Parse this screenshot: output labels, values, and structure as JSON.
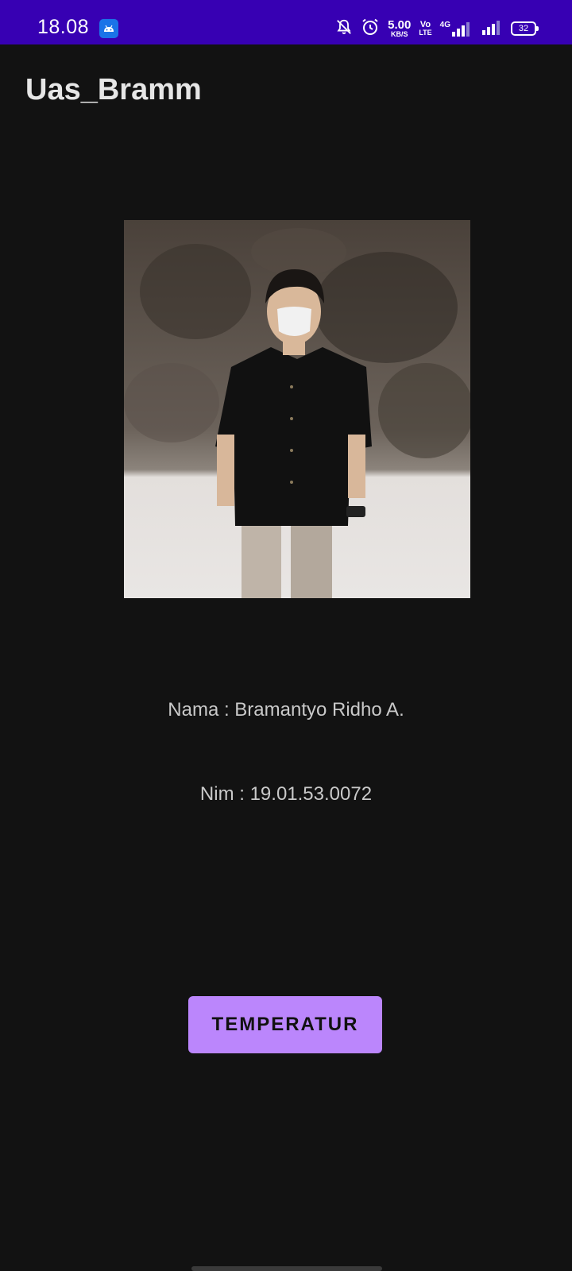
{
  "status_bar": {
    "time": "18.08",
    "app_icon": "android-icon",
    "icons": [
      "notifications-off-icon",
      "alarm-icon"
    ],
    "net_speed_value": "5.00",
    "net_speed_unit": "KB/S",
    "volte_top": "Vo",
    "volte_bottom": "LTE",
    "network_label": "4G",
    "battery_level": "32",
    "color": "#3700b3"
  },
  "app_bar": {
    "title": "Uas_Bramm"
  },
  "profile": {
    "photo": "profile-photo",
    "name_label": "Nama : Bramantyo Ridho A.",
    "nim_label": "Nim : 19.01.53.0072"
  },
  "actions": {
    "temperature_button_label": "TEMPERATUR",
    "accent_color": "#bb86fc"
  },
  "theme": {
    "background": "#121212"
  }
}
